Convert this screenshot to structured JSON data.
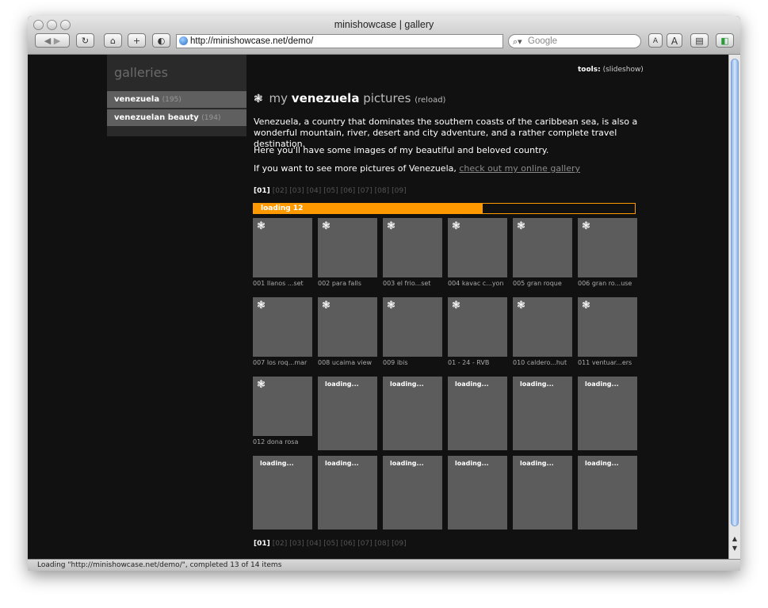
{
  "window": {
    "title": "minishowcase | gallery",
    "url": "http://minishowcase.net/demo/",
    "search_placeholder": "Google",
    "status": "Loading \"http://minishowcase.net/demo/\", completed 13 of 14 items",
    "toolbar": {
      "text_smaller": "A",
      "text_bigger": "A"
    }
  },
  "sidebar": {
    "title": "galleries",
    "items": [
      {
        "label": "venezuela",
        "count": "(195)"
      },
      {
        "label": "venezuelan beauty",
        "count": "(194)"
      }
    ]
  },
  "tools": {
    "label": "tools:",
    "link": "(slideshow)"
  },
  "gallery": {
    "heading_prefix": "my",
    "heading_name": "venezuela",
    "heading_suffix": "pictures",
    "reload": "(reload)",
    "description": "Venezuela, a country that dominates the southern coasts of the caribbean sea, is also a wonderful mountain, river, desert and city adventure, and a rather complete travel destination.",
    "line2": "Here you'll have some images of my beautiful and beloved country.",
    "line3_text": "If you want to see more pictures of Venezuela,",
    "line3_link": "check out my online gallery"
  },
  "pages": [
    "[01]",
    "[02]",
    "[03]",
    "[04]",
    "[05]",
    "[06]",
    "[07]",
    "[08]",
    "[09]"
  ],
  "current_page": "[01]",
  "loading": {
    "label": "loading 12",
    "progress": 0.6
  },
  "loading_label": "loading...",
  "thumbnails": [
    "001 llanos ...set",
    "002 para falls",
    "003 el frio...set",
    "004 kavac c...yon",
    "005 gran roque",
    "006 gran ro...use",
    "007 los roq...mar",
    "008 ucaima view",
    "009 ibis",
    "01 - 24 - RVB",
    "010 caldero...hut",
    "011 ventuar...ers",
    "012 dona rosa"
  ],
  "colors": {
    "accent": "#ff9900",
    "background": "#111111",
    "tile": "#5c5c5c"
  }
}
